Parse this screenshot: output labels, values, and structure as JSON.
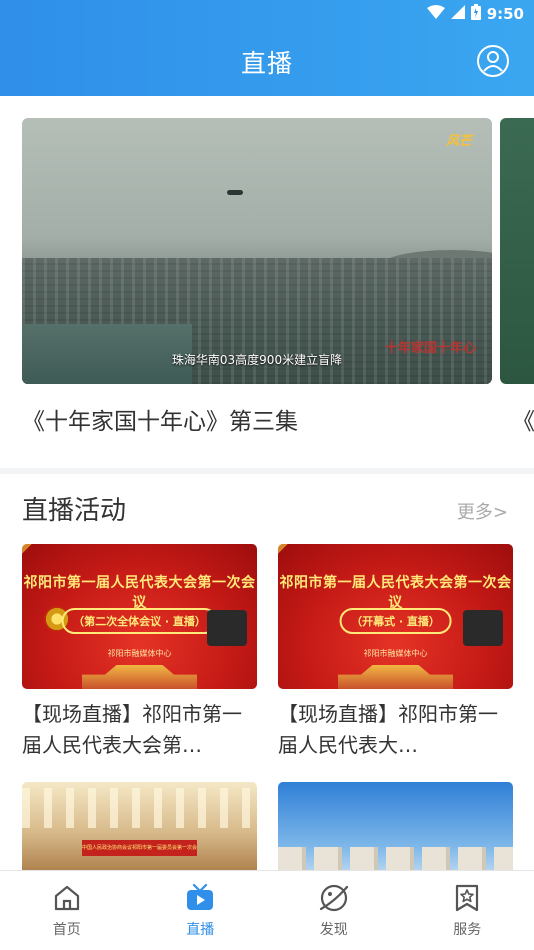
{
  "status_bar": {
    "time": "9:50"
  },
  "header": {
    "title": "直播"
  },
  "featured": {
    "items": [
      {
        "title": "《十年家国十年心》第三集",
        "thumbnail_caption": "珠海华南03高度900米建立盲降",
        "watermark": "风芒",
        "seal": "十年家国十年心"
      },
      {
        "title": "《十"
      }
    ]
  },
  "live_section": {
    "title": "直播活动",
    "more": "更多>",
    "cards": [
      {
        "title": "【现场直播】祁阳市第一届人民代表大会第…",
        "banner": "祁阳市第一届人民代表大会第一次会议",
        "sub": "（第二次全体会议 · 直播）",
        "foot": "祁阳市融媒体中心"
      },
      {
        "title": "【现场直播】祁阳市第一届人民代表大…",
        "banner": "祁阳市第一届人民代表大会第一次会议",
        "sub": "（开幕式 · 直播）",
        "foot": "祁阳市融媒体中心"
      },
      {
        "title": "",
        "thumb_text": "中国人民政治协商会议祁阳市第一届委员会第一次会议"
      },
      {
        "title": ""
      }
    ]
  },
  "tabbar": {
    "tabs": [
      {
        "label": "首页",
        "icon": "home-icon",
        "active": false
      },
      {
        "label": "直播",
        "icon": "tv-play-icon",
        "active": true
      },
      {
        "label": "发现",
        "icon": "discover-icon",
        "active": false
      },
      {
        "label": "服务",
        "icon": "service-star-icon",
        "active": false
      }
    ]
  },
  "colors": {
    "accent": "#2f8fe9",
    "header_start": "#2f8fe9",
    "header_end": "#3aa6f0"
  }
}
